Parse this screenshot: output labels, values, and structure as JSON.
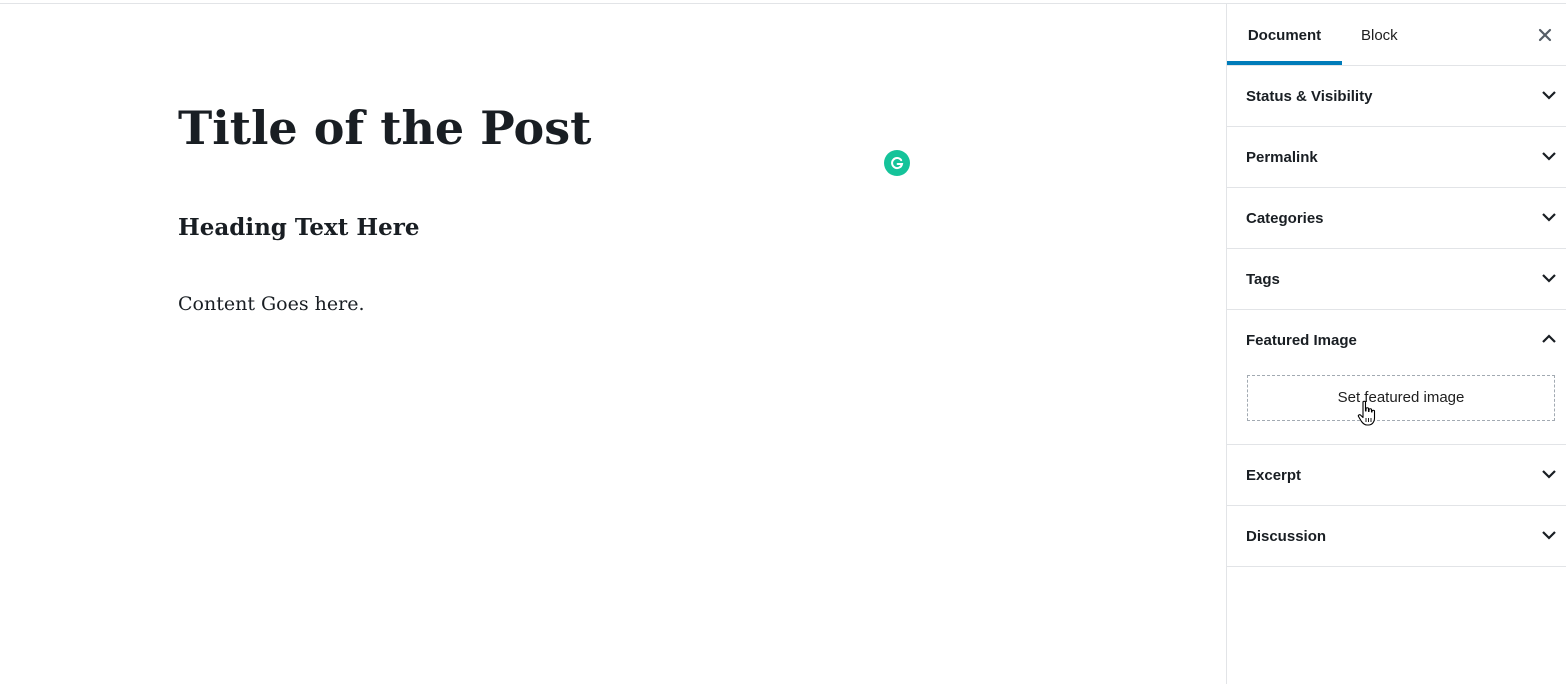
{
  "editor": {
    "post_title": "Title of the Post",
    "heading": "Heading Text Here",
    "paragraph": "Content Goes here."
  },
  "sidebar": {
    "tabs": [
      {
        "label": "Document",
        "active": true
      },
      {
        "label": "Block",
        "active": false
      }
    ],
    "close_label": "×",
    "panels": {
      "status_visibility": {
        "label": "Status & Visibility",
        "expanded": false
      },
      "permalink": {
        "label": "Permalink",
        "expanded": false
      },
      "categories": {
        "label": "Categories",
        "expanded": false
      },
      "tags": {
        "label": "Tags",
        "expanded": false
      },
      "featured_image": {
        "label": "Featured Image",
        "expanded": true,
        "button_label": "Set featured image"
      },
      "excerpt": {
        "label": "Excerpt",
        "expanded": false
      },
      "discussion": {
        "label": "Discussion",
        "expanded": false
      }
    }
  },
  "icons": {
    "grammarly": "grammarly-icon",
    "close": "close-icon",
    "chevron_down": "chevron-down-icon",
    "chevron_up": "chevron-up-icon",
    "cursor": "hand-pointer-icon"
  },
  "colors": {
    "accent": "#007cba",
    "text": "#191e23",
    "border": "#e2e4e7",
    "grammarly": "#15c39a"
  }
}
